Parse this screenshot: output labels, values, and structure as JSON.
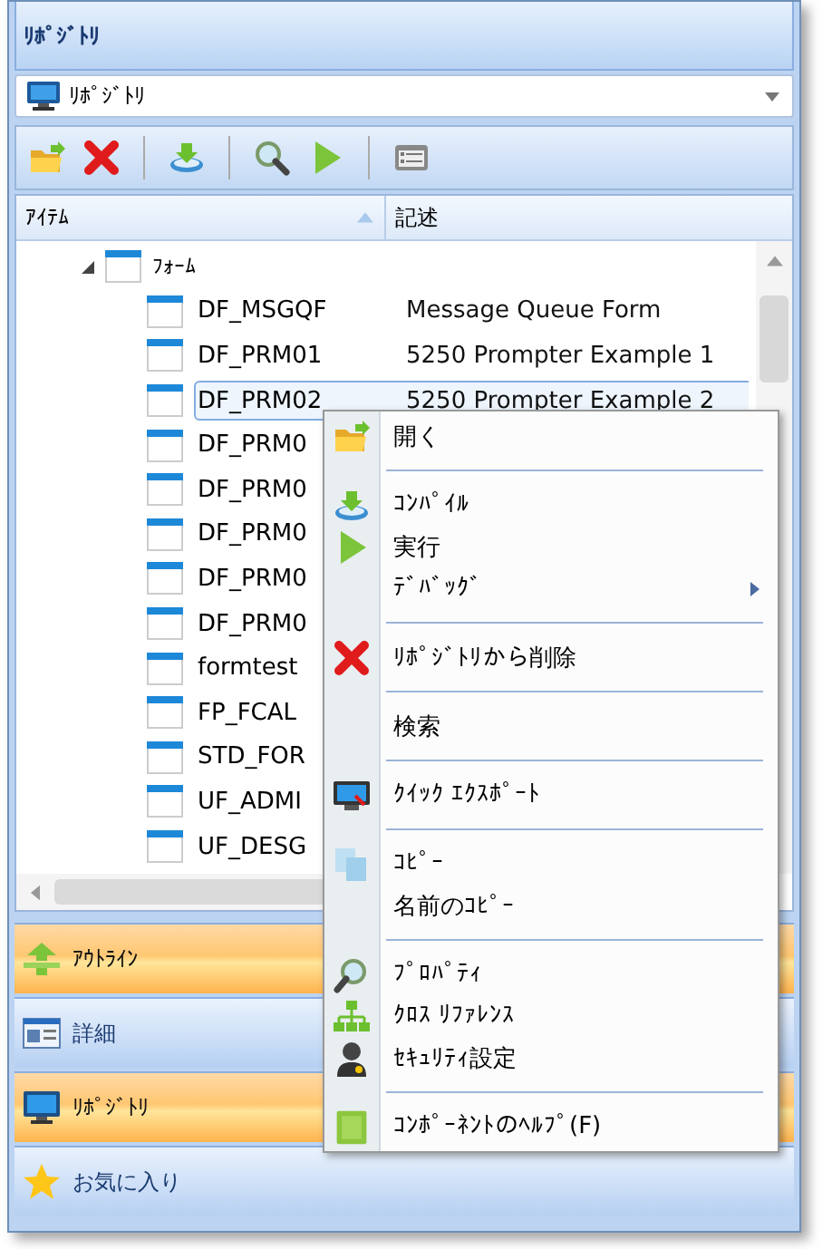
{
  "panel": {
    "title": "ﾘﾎﾟｼﾞﾄﾘ"
  },
  "selector": {
    "value": "ﾘﾎﾟｼﾞﾄﾘ"
  },
  "columns": [
    {
      "label": "ｱｲﾃﾑ",
      "sorted": true
    },
    {
      "label": "記述",
      "sorted": false
    }
  ],
  "tree": [
    {
      "label": "ﾌｫｰﾑ",
      "expanded": true,
      "children": [
        {
          "name": "DF_MSGQF",
          "description": "Message Queue Form",
          "selected": false
        },
        {
          "name": "DF_PRM01",
          "description": "5250 Prompter Example 1",
          "selected": false
        },
        {
          "name": "DF_PRM02",
          "description": "5250 Prompter Example 2",
          "selected": true
        },
        {
          "name": "DF_PRM0",
          "selected": false
        },
        {
          "name": "DF_PRM0",
          "selected": false
        },
        {
          "name": "DF_PRM0",
          "selected": false
        },
        {
          "name": "DF_PRM0",
          "selected": false
        },
        {
          "name": "DF_PRM0",
          "selected": false
        },
        {
          "name": "formtest",
          "selected": false
        },
        {
          "name": "FP_FCAL",
          "selected": false
        },
        {
          "name": "STD_FOR",
          "selected": false
        },
        {
          "name": "UF_ADMI",
          "selected": false
        },
        {
          "name": "UF_DESG",
          "selected": false
        }
      ]
    }
  ],
  "context_menu": [
    {
      "kind": "item",
      "label": "開く"
    },
    {
      "kind": "separator"
    },
    {
      "kind": "item",
      "label": "ｺﾝﾊﾟｲﾙ"
    },
    {
      "kind": "item",
      "label": "実行"
    },
    {
      "kind": "item",
      "label": "ﾃﾞﾊﾞｯｸﾞ",
      "submenu": true
    },
    {
      "kind": "separator"
    },
    {
      "kind": "item",
      "label": "ﾘﾎﾟｼﾞﾄﾘから削除"
    },
    {
      "kind": "separator"
    },
    {
      "kind": "item",
      "label": "検索"
    },
    {
      "kind": "separator"
    },
    {
      "kind": "item",
      "label": "ｸｲｯｸ ｴｸｽﾎﾟｰﾄ"
    },
    {
      "kind": "separator"
    },
    {
      "kind": "item",
      "label": "ｺﾋﾟｰ"
    },
    {
      "kind": "item",
      "label": "名前のｺﾋﾟｰ"
    },
    {
      "kind": "separator"
    },
    {
      "kind": "item",
      "label": "ﾌﾟﾛﾊﾟﾃｨ"
    },
    {
      "kind": "item",
      "label": "ｸﾛｽ ﾘﾌｧﾚﾝｽ"
    },
    {
      "kind": "item",
      "label": "ｾｷｭﾘﾃｨ設定"
    },
    {
      "kind": "separator"
    },
    {
      "kind": "item",
      "label": "ｺﾝﾎﾟｰﾈﾝﾄのﾍﾙﾌﾟ(F)"
    }
  ],
  "navigation": [
    {
      "label": "ｱｳﾄﾗｲﾝ",
      "highlighted": true
    },
    {
      "label": "詳細",
      "highlighted": false
    },
    {
      "label": "ﾘﾎﾟｼﾞﾄﾘ",
      "highlighted": true
    },
    {
      "label": "お気に入り",
      "highlighted": false
    }
  ]
}
